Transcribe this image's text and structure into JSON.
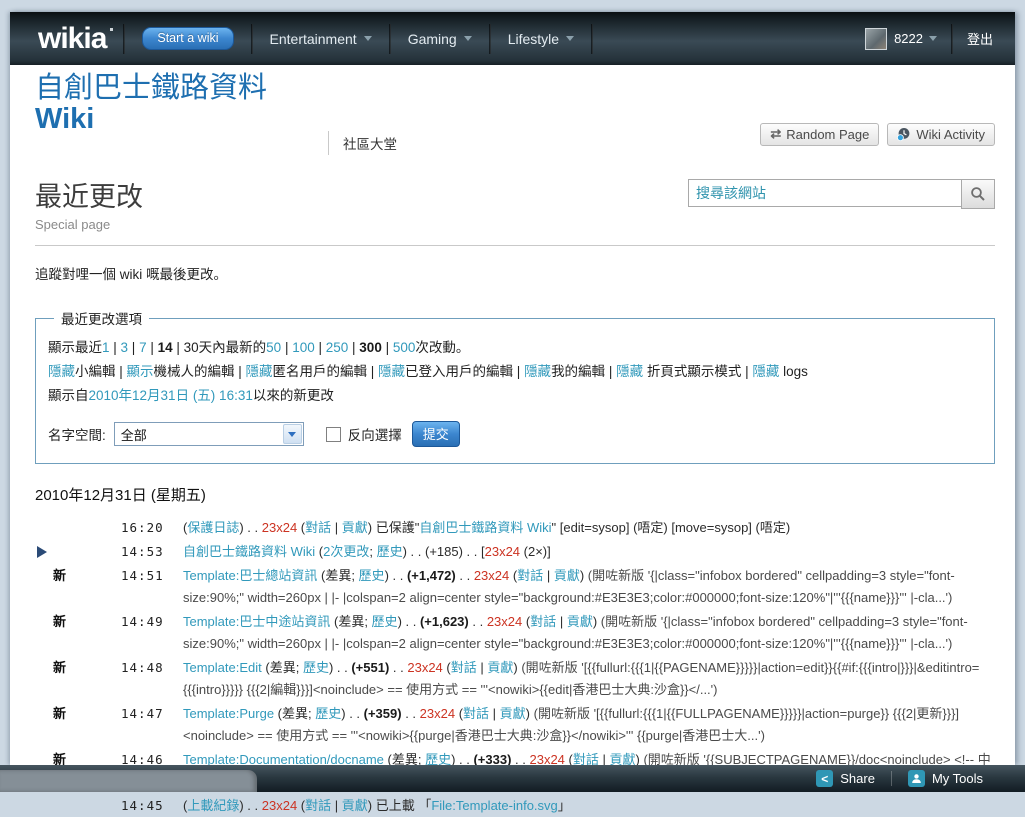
{
  "colors": {
    "accent_teal": "#3199bb",
    "redlink": "#cc3322",
    "title_blue": "#1e6fb0",
    "button_blue": "#2a6fb4"
  },
  "global_nav": {
    "logo": "wikia",
    "start_wiki_label": "Start a wiki",
    "items": [
      {
        "label": "Entertainment"
      },
      {
        "label": "Gaming"
      },
      {
        "label": "Lifestyle"
      }
    ],
    "username": "8222",
    "logout_label": "登出"
  },
  "wiki_header": {
    "title_line1": "自創巴士鐵路資料",
    "title_line2": "Wiki",
    "nav_link": "社區大堂",
    "random_page_label": "Random Page",
    "wiki_activity_label": "Wiki Activity"
  },
  "page_header": {
    "title": "最近更改",
    "subtitle": "Special page",
    "search_placeholder": "搜尋該網站"
  },
  "intro": "追蹤對哩一個 wiki 嘅最後更改。",
  "options": {
    "legend": "最近更改選項",
    "line1": [
      {
        "t": "text",
        "s": "顯示最近"
      },
      {
        "t": "link",
        "s": "1"
      },
      {
        "t": "text",
        "s": " | "
      },
      {
        "t": "link",
        "s": "3"
      },
      {
        "t": "text",
        "s": " | "
      },
      {
        "t": "link",
        "s": "7"
      },
      {
        "t": "text",
        "s": " | "
      },
      {
        "t": "bold",
        "s": "14"
      },
      {
        "t": "text",
        "s": " | 30天內最新的"
      },
      {
        "t": "link",
        "s": "50"
      },
      {
        "t": "text",
        "s": " | "
      },
      {
        "t": "link",
        "s": "100"
      },
      {
        "t": "text",
        "s": " | "
      },
      {
        "t": "link",
        "s": "250"
      },
      {
        "t": "text",
        "s": " | "
      },
      {
        "t": "bold",
        "s": "300"
      },
      {
        "t": "text",
        "s": " | "
      },
      {
        "t": "link",
        "s": "500"
      },
      {
        "t": "text",
        "s": "次改動。"
      }
    ],
    "line2": [
      {
        "t": "link",
        "s": "隱藏"
      },
      {
        "t": "text",
        "s": "小編輯 | "
      },
      {
        "t": "link",
        "s": "顯示"
      },
      {
        "t": "text",
        "s": "機械人的編輯 | "
      },
      {
        "t": "link",
        "s": "隱藏"
      },
      {
        "t": "text",
        "s": "匿名用戶的編輯 | "
      },
      {
        "t": "link",
        "s": "隱藏"
      },
      {
        "t": "text",
        "s": "已登入用戶的編輯 | "
      },
      {
        "t": "link",
        "s": "隱藏"
      },
      {
        "t": "text",
        "s": "我的編輯 | "
      },
      {
        "t": "link",
        "s": "隱藏"
      },
      {
        "t": "text",
        "s": " 折頁式顯示模式 | "
      },
      {
        "t": "link",
        "s": "隱藏"
      },
      {
        "t": "text",
        "s": " logs"
      }
    ],
    "line3": [
      {
        "t": "text",
        "s": "顯示自"
      },
      {
        "t": "link",
        "s": "2010年12月31日 (五) 16:31"
      },
      {
        "t": "text",
        "s": "以來的新更改"
      }
    ],
    "namespace_label": "名字空間:",
    "namespace_value": "全部",
    "invert_label": "反向選擇",
    "submit_label": "提交"
  },
  "changes": {
    "date_heading": "2010年12月31日 (星期五)",
    "rows": [
      {
        "time": "16:20",
        "flag": "",
        "arrow": false,
        "segments": [
          {
            "t": "text",
            "s": "("
          },
          {
            "t": "link",
            "s": "保護日誌"
          },
          {
            "t": "text",
            "s": ") . . "
          },
          {
            "t": "red",
            "s": "23x24"
          },
          {
            "t": "text",
            "s": " ("
          },
          {
            "t": "link",
            "s": "對話"
          },
          {
            "t": "text",
            "s": " | "
          },
          {
            "t": "link",
            "s": "貢獻"
          },
          {
            "t": "text",
            "s": ") 已保護\""
          },
          {
            "t": "link",
            "s": "自創巴士鐵路資料 Wiki"
          },
          {
            "t": "text",
            "s": "\" [edit=sysop] (唔定) [move=sysop] (唔定)"
          }
        ]
      },
      {
        "time": "14:53",
        "flag": "",
        "arrow": true,
        "segments": [
          {
            "t": "link",
            "s": "自創巴士鐵路資料 Wiki"
          },
          {
            "t": "text",
            "s": " ("
          },
          {
            "t": "link",
            "s": "2次更改"
          },
          {
            "t": "text",
            "s": "; "
          },
          {
            "t": "link",
            "s": "歷史"
          },
          {
            "t": "text",
            "s": ") . . (+185) . . ["
          },
          {
            "t": "red",
            "s": "23x24"
          },
          {
            "t": "text",
            "s": " (2×)]"
          }
        ]
      },
      {
        "time": "14:51",
        "flag": "新",
        "arrow": false,
        "segments": [
          {
            "t": "link",
            "s": "Template:巴士總站資訊"
          },
          {
            "t": "text",
            "s": " (差異; "
          },
          {
            "t": "link",
            "s": "歷史"
          },
          {
            "t": "text",
            "s": ") . . "
          },
          {
            "t": "bold",
            "s": "(+1,472)"
          },
          {
            "t": "text",
            "s": " . . "
          },
          {
            "t": "red",
            "s": "23x24"
          },
          {
            "t": "text",
            "s": " ("
          },
          {
            "t": "link",
            "s": "對話"
          },
          {
            "t": "text",
            "s": " | "
          },
          {
            "t": "link",
            "s": "貢獻"
          },
          {
            "t": "text",
            "s": ") "
          },
          {
            "t": "comment",
            "s": "(開咗新版 '{|class=\"infobox bordered\" cellpadding=3 style=\"font-size:90%;\" width=260px | |- |colspan=2 align=center style=\"background:#E3E3E3;color:#000000;font-size:120%\"|'''{{{name}}}''' |-cla...')"
          }
        ]
      },
      {
        "time": "14:49",
        "flag": "新",
        "arrow": false,
        "segments": [
          {
            "t": "link",
            "s": "Template:巴士中途站資訊"
          },
          {
            "t": "text",
            "s": " (差異; "
          },
          {
            "t": "link",
            "s": "歷史"
          },
          {
            "t": "text",
            "s": ") . . "
          },
          {
            "t": "bold",
            "s": "(+1,623)"
          },
          {
            "t": "text",
            "s": " . . "
          },
          {
            "t": "red",
            "s": "23x24"
          },
          {
            "t": "text",
            "s": " ("
          },
          {
            "t": "link",
            "s": "對話"
          },
          {
            "t": "text",
            "s": " | "
          },
          {
            "t": "link",
            "s": "貢獻"
          },
          {
            "t": "text",
            "s": ") "
          },
          {
            "t": "comment",
            "s": "(開咗新版 '{|class=\"infobox bordered\" cellpadding=3 style=\"font-size:90%;\" width=260px | |- |colspan=2 align=center style=\"background:#E3E3E3;color:#000000;font-size:120%\"|'''{{{name}}}''' |-cla...')"
          }
        ]
      },
      {
        "time": "14:48",
        "flag": "新",
        "arrow": false,
        "segments": [
          {
            "t": "link",
            "s": "Template:Edit"
          },
          {
            "t": "text",
            "s": " (差異; "
          },
          {
            "t": "link",
            "s": "歷史"
          },
          {
            "t": "text",
            "s": ") . . "
          },
          {
            "t": "bold",
            "s": "(+551)"
          },
          {
            "t": "text",
            "s": " . . "
          },
          {
            "t": "red",
            "s": "23x24"
          },
          {
            "t": "text",
            "s": " ("
          },
          {
            "t": "link",
            "s": "對話"
          },
          {
            "t": "text",
            "s": " | "
          },
          {
            "t": "link",
            "s": "貢獻"
          },
          {
            "t": "text",
            "s": ") "
          },
          {
            "t": "comment",
            "s": "(開咗新版 '[{{fullurl:{{{1|{{PAGENAME}}}}}|action=edit}}{{#if:{{{intro|}}}|&editintro={{{intro}}}}} {{{2|編輯}}}]<noinclude> == 使用方式 == '''<nowiki>{{edit|香港巴士大典:沙盒}}</...')"
          }
        ]
      },
      {
        "time": "14:47",
        "flag": "新",
        "arrow": false,
        "segments": [
          {
            "t": "link",
            "s": "Template:Purge"
          },
          {
            "t": "text",
            "s": " (差異; "
          },
          {
            "t": "link",
            "s": "歷史"
          },
          {
            "t": "text",
            "s": ") . . "
          },
          {
            "t": "bold",
            "s": "(+359)"
          },
          {
            "t": "text",
            "s": " . . "
          },
          {
            "t": "red",
            "s": "23x24"
          },
          {
            "t": "text",
            "s": " ("
          },
          {
            "t": "link",
            "s": "對話"
          },
          {
            "t": "text",
            "s": " | "
          },
          {
            "t": "link",
            "s": "貢獻"
          },
          {
            "t": "text",
            "s": ") "
          },
          {
            "t": "comment",
            "s": "(開咗新版 '[{{fullurl:{{{1|{{FULLPAGENAME}}}}}|action=purge}} {{{2|更新}}}]<noinclude> == 使用方式 == '''<nowiki>{{purge|香港巴士大典:沙盒}}</nowiki>''' {{purge|香港巴士大...')"
          }
        ]
      },
      {
        "time": "14:46",
        "flag": "新",
        "arrow": false,
        "segments": [
          {
            "t": "link",
            "s": "Template:Documentation/docname"
          },
          {
            "t": "text",
            "s": " (差異; "
          },
          {
            "t": "link",
            "s": "歷史"
          },
          {
            "t": "text",
            "s": ") . . "
          },
          {
            "t": "bold",
            "s": "(+333)"
          },
          {
            "t": "text",
            "s": " . . "
          },
          {
            "t": "red",
            "s": "23x24"
          },
          {
            "t": "text",
            "s": " ("
          },
          {
            "t": "link",
            "s": "對話"
          },
          {
            "t": "text",
            "s": " | "
          },
          {
            "t": "link",
            "s": "貢獻"
          },
          {
            "t": "text",
            "s": ") "
          },
          {
            "t": "comment",
            "s": "(開咗新版 '{{SUBJECTPAGENAME}}/doc<noinclude> <!-- 中文沒有建立模板的沙盒和範例測試，先直接返回 /doc 子頁面。 --> {{#switch: {{SUBPAGENAME}} |沙盒|sandbox|範例測...')"
          }
        ]
      },
      {
        "time": "14:45",
        "flag": "",
        "arrow": false,
        "segments": [
          {
            "t": "text",
            "s": "("
          },
          {
            "t": "link",
            "s": "上載紀錄"
          },
          {
            "t": "text",
            "s": ") . . "
          },
          {
            "t": "red",
            "s": "23x24"
          },
          {
            "t": "text",
            "s": " ("
          },
          {
            "t": "link",
            "s": "對話"
          },
          {
            "t": "text",
            "s": " | "
          },
          {
            "t": "link",
            "s": "貢獻"
          },
          {
            "t": "text",
            "s": ") 已上載 「"
          },
          {
            "t": "link",
            "s": "File:Template-info.svg"
          },
          {
            "t": "text",
            "s": "」"
          }
        ]
      }
    ]
  },
  "toolbar": {
    "share_label": "Share",
    "my_tools_label": "My Tools"
  }
}
